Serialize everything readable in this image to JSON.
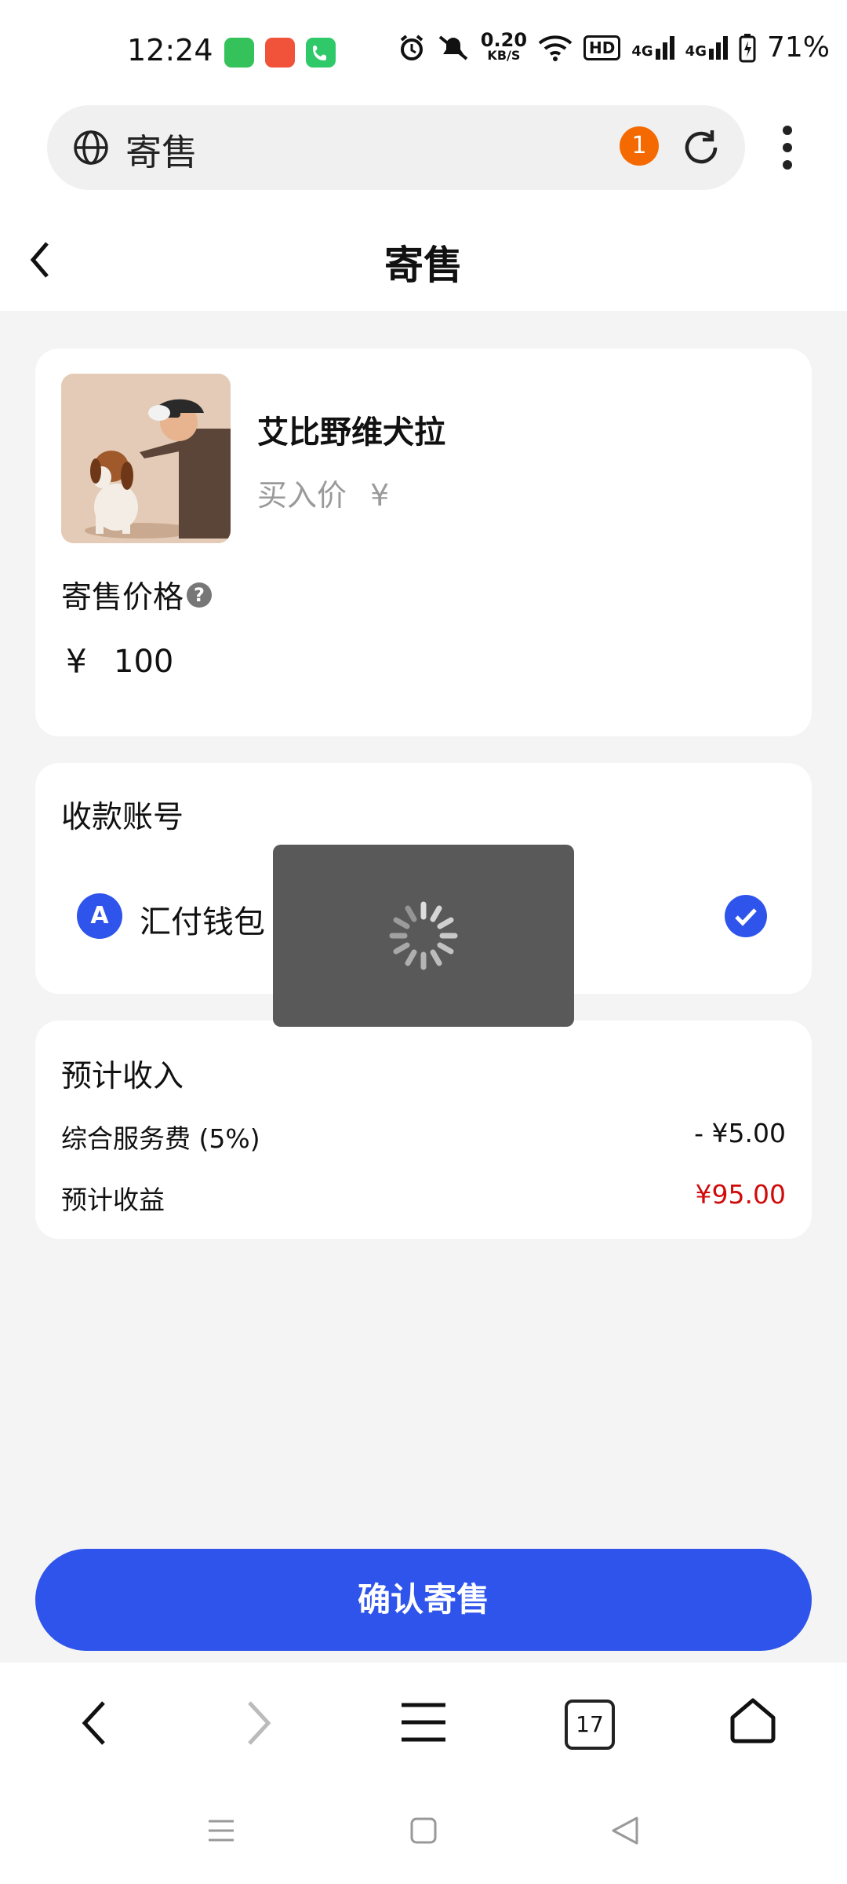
{
  "status_bar": {
    "time": "12:24",
    "network_speed": "0.20",
    "network_unit": "KB/S",
    "hd_label": "HD",
    "net_type_1": "4G",
    "net_type_2": "4G",
    "battery": "71%",
    "apps": [
      "messages-icon",
      "app-icon",
      "phone-icon"
    ]
  },
  "browser": {
    "url_text": "寄售",
    "badge_count": "1"
  },
  "header": {
    "title": "寄售"
  },
  "product": {
    "name": "艾比野维犬拉",
    "buy_price_label": "买入价",
    "buy_price_currency": "¥"
  },
  "consign_price": {
    "label": "寄售价格",
    "help": "?",
    "currency": "¥",
    "value": "100"
  },
  "account": {
    "label": "收款账号",
    "icon_letter": "A",
    "name": "汇付钱包",
    "selected": true
  },
  "income": {
    "label": "预计收入",
    "fee_label": "综合服务费 (5%)",
    "fee_value": "- ¥5.00",
    "profit_label": "预计收益",
    "profit_value": "¥95.00"
  },
  "confirm_button": "确认寄售",
  "bottom_nav": {
    "tab_count": "17"
  },
  "colors": {
    "accent": "#2f54eb",
    "badge": "#f56a00",
    "profit": "#d10a0a",
    "loader_bg": "#595959"
  }
}
